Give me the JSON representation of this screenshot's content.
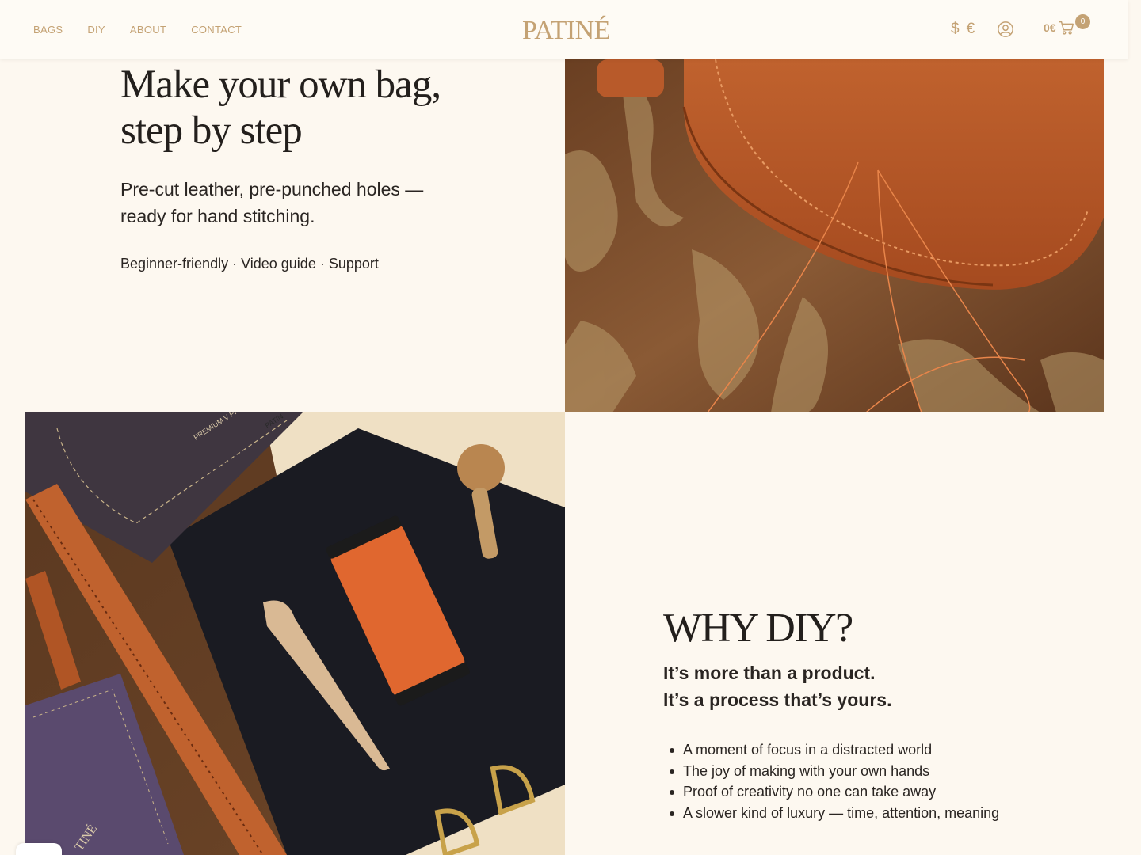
{
  "header": {
    "nav": [
      "BAGS",
      "DIY",
      "ABOUT",
      "CONTACT"
    ],
    "logo": "PATINÉ",
    "currencies": [
      "$",
      "€"
    ],
    "cart_total": "0€",
    "cart_count": "0"
  },
  "hero": {
    "title_line1": "Make your own bag,",
    "title_line2": "step by step",
    "subtitle_line1": "Pre-cut leather, pre-punched holes —",
    "subtitle_line2": "ready for hand stitching.",
    "features": "Beginner-friendly · Video guide · Support"
  },
  "kit_image": {
    "notebook_text": "PREMIUM V PRECISIO",
    "box_text": "PATIN",
    "corner_logo": "TINÉ"
  },
  "why": {
    "title": "WHY DIY?",
    "subtitle_line1": "It’s more than a product.",
    "subtitle_line2": "It’s a process that’s yours.",
    "points": [
      "A moment of focus in a distracted world",
      "The joy of making with your own hands",
      "Proof of creativity no one can take away",
      "A slower kind of luxury — time, attention, meaning"
    ]
  },
  "colors": {
    "background": "#fdf8f0",
    "accent": "#c4a274",
    "text": "#231f1c",
    "leather": "#c0622e"
  },
  "icons": {
    "account": "user-circle-icon",
    "cart": "shopping-cart-icon"
  }
}
